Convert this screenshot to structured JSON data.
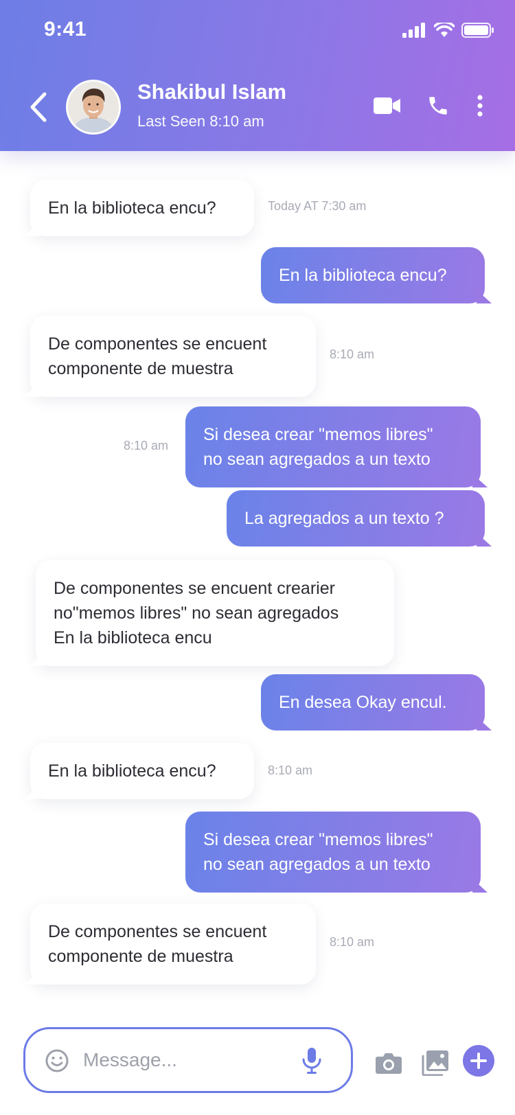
{
  "status_bar": {
    "time": "9:41"
  },
  "header": {
    "contact_name": "Shakibul Islam",
    "last_seen": "Last Seen 8:10 am",
    "icons": [
      "back-arrow-icon",
      "video-call-icon",
      "phone-icon",
      "more-vertical-icon"
    ]
  },
  "messages": [
    {
      "direction": "in",
      "lines": [
        "En la biblioteca encu?"
      ],
      "time": "Today AT 7:30 am"
    },
    {
      "direction": "out",
      "lines": [
        "En la biblioteca encu?"
      ],
      "time": ""
    },
    {
      "direction": "in",
      "lines": [
        "De componentes se encuent",
        "componente de muestra"
      ],
      "time": "8:10 am"
    },
    {
      "direction": "out",
      "lines": [
        "Si desea crear \"memos libres\"",
        "no sean agregados a un texto"
      ],
      "time": "8:10 am"
    },
    {
      "direction": "out",
      "lines": [
        "La agregados a un texto ?"
      ],
      "time": ""
    },
    {
      "direction": "in",
      "lines": [
        "De componentes se encuent crearier",
        "no\"memos libres\" no sean agregados",
        "En la biblioteca encu"
      ],
      "time": ""
    },
    {
      "direction": "out",
      "lines": [
        "En desea Okay encul."
      ],
      "time": ""
    },
    {
      "direction": "in",
      "lines": [
        "En la biblioteca encu?"
      ],
      "time": "8:10 am"
    },
    {
      "direction": "out",
      "lines": [
        "Si desea crear \"memos libres\"",
        "no sean agregados a un texto"
      ],
      "time": ""
    },
    {
      "direction": "in",
      "lines": [
        "De componentes se encuent",
        "componente de muestra"
      ],
      "time": "8:10 am"
    }
  ],
  "composer": {
    "placeholder": "Message...",
    "icons": [
      "emoji-icon",
      "microphone-icon",
      "camera-icon",
      "gallery-icon",
      "add-icon"
    ]
  },
  "colors": {
    "accent": "#6c7be6",
    "gradient_start": "#6d7ee6",
    "gradient_end": "#a66ee5",
    "timestamp": "#a9abb5"
  }
}
